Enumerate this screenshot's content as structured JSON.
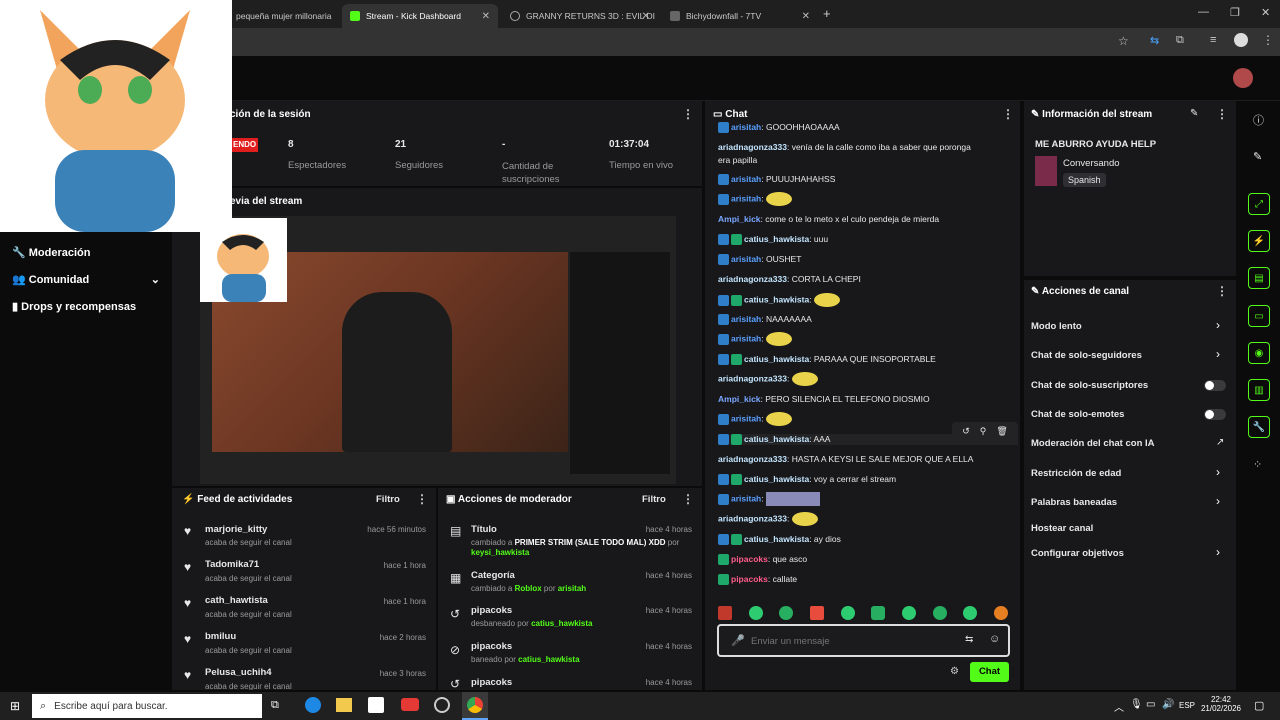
{
  "browser": {
    "tabs": [
      {
        "title": "pequeña mujer millonaria"
      },
      {
        "title": "Stream - Kick Dashboard"
      },
      {
        "title": "GRANNY RETURNS 3D : EVIL DI"
      },
      {
        "title": "Bichydownfall - 7TV"
      }
    ]
  },
  "session": {
    "title": "ción de la sesión",
    "live_badge": "ENDO",
    "stats": [
      {
        "value": "8",
        "label": "Espectadores"
      },
      {
        "value": "21",
        "label": "Seguidores"
      },
      {
        "value": "-",
        "label": "Cantidad de suscripciones"
      },
      {
        "value": "01:37:04",
        "label": "Tiempo en vivo"
      }
    ]
  },
  "preview": {
    "title": "evia del stream"
  },
  "sidebar": {
    "items": [
      {
        "label": "Moderación"
      },
      {
        "label": "Comunidad"
      },
      {
        "label": "Drops y recompensas"
      }
    ]
  },
  "activity": {
    "title": "Feed de actividades",
    "filter": "Filtro",
    "items": [
      {
        "user": "marjorie_kitty",
        "time": "hace 56 minutos",
        "action": "acaba de seguir el canal"
      },
      {
        "user": "Tadomika71",
        "time": "hace 1 hora",
        "action": "acaba de seguir el canal"
      },
      {
        "user": "cath_hawtista",
        "time": "hace 1 hora",
        "action": "acaba de seguir el canal"
      },
      {
        "user": "bmiluu",
        "time": "hace 2 horas",
        "action": "acaba de seguir el canal"
      },
      {
        "user": "Pelusa_uchih4",
        "time": "hace 3 horas",
        "action": "acaba de seguir el canal"
      }
    ]
  },
  "modactions": {
    "title": "Acciones de moderador",
    "filter": "Filtro",
    "items": [
      {
        "title": "Título",
        "time": "hace 4 horas",
        "line1": "cambiado a ",
        "highlight1": "PRIMER STRIM (SALE TODO MAL) XDD",
        "mid": " por",
        "user": "keysi_hawkista"
      },
      {
        "title": "Categoría",
        "time": "hace 4 horas",
        "line1": "cambiado a ",
        "highlight1": "Roblox",
        "mid": " por ",
        "user": "arisitah"
      },
      {
        "title": "pipacoks",
        "time": "hace 4 horas",
        "line1": "desbaneado por ",
        "highlight1": "",
        "mid": "",
        "user": "catius_hawkista"
      },
      {
        "title": "pipacoks",
        "time": "hace 4 horas",
        "line1": "baneado por ",
        "highlight1": "",
        "mid": "",
        "user": "catius_hawkista"
      },
      {
        "title": "pipacoks",
        "time": "hace 4 horas",
        "line1": "",
        "highlight1": "",
        "mid": "",
        "user": ""
      }
    ]
  },
  "chat": {
    "title": "Chat",
    "messages": [
      {
        "user": "arisitah",
        "text": ": GOOOHHAOAAAA"
      },
      {
        "user": "ariadnagonza333",
        "text": ": venía de la calle como iba a saber que poronga"
      },
      {
        "user": "",
        "text": "era papilla"
      },
      {
        "user": "arisitah",
        "text": ": PUUUJHAHAHSS"
      },
      {
        "user": "arisitah",
        "text": ":"
      },
      {
        "user": "Ampi_kick",
        "text": ": come o te lo meto x el culo pendeja de mierda"
      },
      {
        "user": "catius_hawkista",
        "text": ": uuu"
      },
      {
        "user": "arisitah",
        "text": ": OUSHET"
      },
      {
        "user": "ariadnagonza333",
        "text": ": CORTA LA CHEPI"
      },
      {
        "user": "catius_hawkista",
        "text": ":"
      },
      {
        "user": "arisitah",
        "text": ": NAAAAAAA"
      },
      {
        "user": "arisitah",
        "text": ":"
      },
      {
        "user": "catius_hawkista",
        "text": ": PARAAA QUE INSOPORTABLE"
      },
      {
        "user": "ariadnagonza333",
        "text": ":"
      },
      {
        "user": "Ampi_kick",
        "text": ": PERO SILENCIA EL TELEFONO DIOSMIO"
      },
      {
        "user": "arisitah",
        "text": ":"
      },
      {
        "user": "catius_hawkista",
        "text": ": AAA"
      },
      {
        "user": "ariadnagonza333",
        "text": ": HASTA A KEYSI LE SALE MEJOR QUE A ELLA"
      },
      {
        "user": "catius_hawkista",
        "text": ": voy a cerrar el stream"
      },
      {
        "user": "arisitah",
        "text": ":"
      },
      {
        "user": "ariadnagonza333",
        "text": ":"
      },
      {
        "user": "catius_hawkista",
        "text": ": ay dios"
      },
      {
        "user": "pipacoks",
        "text": ": que asco"
      },
      {
        "user": "pipacoks",
        "text": ": callate"
      }
    ],
    "input_placeholder": "Enviar un mensaje",
    "send_label": "Chat"
  },
  "streaminfo": {
    "title": "Información del stream",
    "stream_title": "ME ABURRO AYUDA HELP",
    "category": "Conversando",
    "language": "Spanish"
  },
  "channelactions": {
    "title": "Acciones de canal",
    "items": [
      {
        "label": "Modo lento",
        "control": "chevron"
      },
      {
        "label": "Chat de solo-seguidores",
        "control": "chevron"
      },
      {
        "label": "Chat de solo-suscriptores",
        "control": "toggle"
      },
      {
        "label": "Chat de solo-emotes",
        "control": "toggle"
      },
      {
        "label": "Moderación del chat con IA",
        "control": "external"
      },
      {
        "label": "Restricción de edad",
        "control": "chevron"
      },
      {
        "label": "Palabras baneadas",
        "control": "chevron"
      },
      {
        "label": "Hostear canal",
        "control": "none"
      },
      {
        "label": "Configurar objetivos",
        "control": "chevron"
      }
    ]
  },
  "taskbar": {
    "search_placeholder": "Escribe aquí para buscar.",
    "lang": "ESP",
    "time": "22:42",
    "date": "21/02/2026"
  },
  "colors": {
    "accent": "#53fc18",
    "panel": "#18181b",
    "bg": "#0b0b0c"
  }
}
